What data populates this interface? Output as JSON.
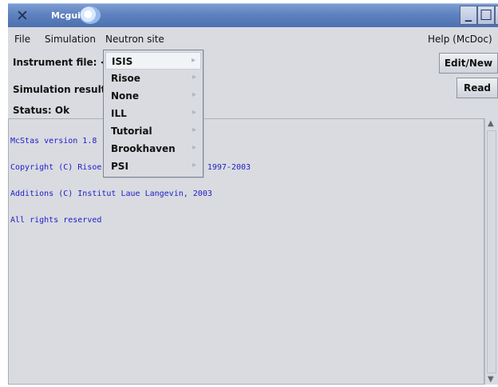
{
  "window": {
    "title": "Mcgui",
    "minimize": "_",
    "maximize": "□",
    "close": "X"
  },
  "menubar": {
    "file": "File",
    "simulation": "Simulation",
    "neutron_site": "Neutron site",
    "help": "Help (McDoc)"
  },
  "rows": {
    "instrument_file": "Instrument file: <N",
    "simulation_results": "Simulation results:",
    "status": "Status: Ok"
  },
  "buttons": {
    "edit_new": "Edit/New",
    "read": "Read"
  },
  "neutron_menu": {
    "items": [
      "ISIS",
      "Risoe",
      "None",
      "ILL",
      "Tutorial",
      "Brookhaven",
      "PSI"
    ]
  },
  "log": {
    "lines": [
      "McStas version 1.8 - Apr. 19, 2004",
      "Copyright (C) Risoe National Laboratory, 1997-2003",
      "Additions (C) Institut Laue Langevin, 2003",
      "All rights reserved"
    ]
  },
  "colors": {
    "titlebar": "#5d80bf",
    "panel": "#d9dbe0",
    "log_text": "#2020c8"
  },
  "icons": [
    "x-app-icon",
    "logo-icon",
    "minimize-icon",
    "maximize-icon",
    "close-icon",
    "submenu-arrow-icon",
    "scroll-up-icon",
    "scroll-down-icon"
  ]
}
